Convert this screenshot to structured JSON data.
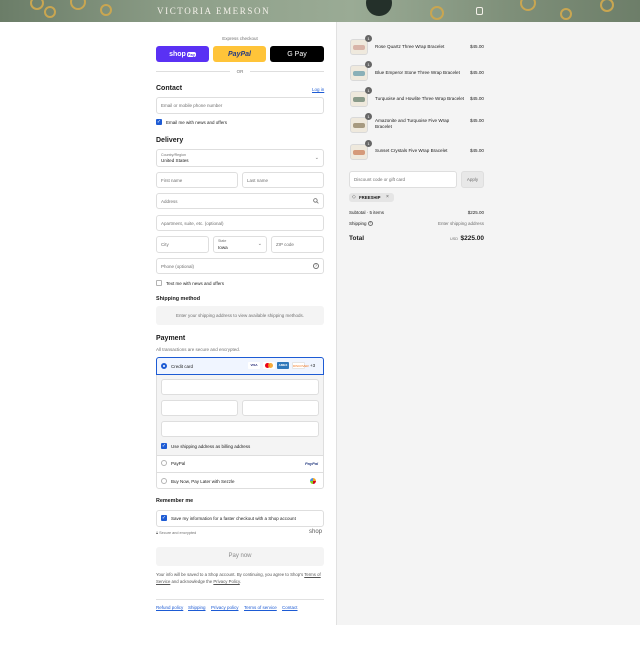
{
  "header": {
    "brand": "VICTORIA EMERSON"
  },
  "express": {
    "label": "Express checkout",
    "shop_pay": "shop",
    "shop_pay_tag": "Pay",
    "paypal": "PayPal",
    "gpay": "G Pay",
    "or": "OR"
  },
  "contact": {
    "title": "Contact",
    "login": "Log in",
    "email_placeholder": "Email or mobile phone number",
    "news_label": "Email me with news and offers"
  },
  "delivery": {
    "title": "Delivery",
    "country_label": "Country/Region",
    "country_value": "United States",
    "first_name": "First name",
    "last_name": "Last name",
    "address": "Address",
    "apartment": "Apartment, suite, etc. (optional)",
    "city": "City",
    "state_label": "State",
    "state_value": "Iowa",
    "zip": "ZIP code",
    "phone": "Phone (optional)",
    "text_label": "Text me with news and offers"
  },
  "shipping_method": {
    "title": "Shipping method",
    "message": "Enter your shipping address to view available shipping methods."
  },
  "payment": {
    "title": "Payment",
    "subtitle": "All transactions are secure and encrypted.",
    "credit_card": "Credit card",
    "cards": [
      "VISA",
      "MC",
      "AMEX",
      "DISCOVER"
    ],
    "more": "+3",
    "billing_label": "Use shipping address as billing address",
    "paypal": "PayPal",
    "paypal_logo": "PayPal",
    "sezzle": "Buy Now, Pay Later with Sezzle"
  },
  "remember": {
    "title": "Remember me",
    "save_label": "Save my information for a faster checkout with a Shop account",
    "secure": "Secure and encrypted",
    "shop": "shop"
  },
  "pay_now": "Pay now",
  "legal": {
    "line1": "Your info will be saved to a Shop account. By continuing, you agree to Shop's",
    "terms": "Terms of Service",
    "mid": "and acknowledge the",
    "privacy": "Privacy Policy",
    "end": "."
  },
  "footer_links": [
    "Refund policy",
    "Shipping",
    "Privacy policy",
    "Terms of service",
    "Contact"
  ],
  "cart": {
    "items": [
      {
        "name": "Rose Quartz Three Wrap Bracelet",
        "price": "$45.00",
        "qty": "1",
        "color": "#d8b4a8"
      },
      {
        "name": "Blue Emperor Stone Three Wrap Bracelet",
        "price": "$45.00",
        "qty": "1",
        "color": "#8ab0b8"
      },
      {
        "name": "Turquoise and Howlite Three Wrap Bracelet",
        "price": "$45.00",
        "qty": "1",
        "color": "#8a9b8a"
      },
      {
        "name": "Amazonite and Turquoise Five Wrap Bracelet",
        "price": "$45.00",
        "qty": "1",
        "color": "#a79a80"
      },
      {
        "name": "Sunset Crystals Five Wrap Bracelet",
        "price": "$45.00",
        "qty": "1",
        "color": "#d59a7a"
      }
    ],
    "discount_placeholder": "Discount code or gift card",
    "apply": "Apply",
    "code": "FREESHIP",
    "subtotal_label": "Subtotal · 5 items",
    "subtotal_value": "$225.00",
    "shipping_label": "Shipping",
    "shipping_value": "Enter shipping address",
    "total_label": "Total",
    "currency": "USD",
    "total_value": "$225.00"
  }
}
